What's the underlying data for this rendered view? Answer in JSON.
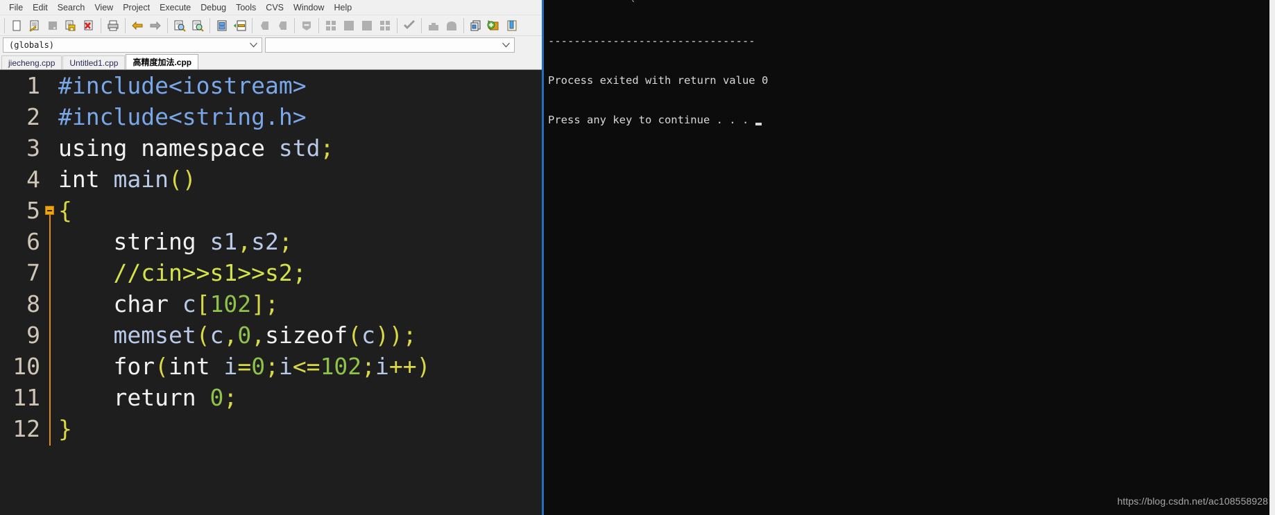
{
  "app": {
    "name": "Dev-C++",
    "accent_color": "#2a6dbf",
    "editor_bg": "#1e1e1e",
    "console_bg": "#0c0c0c"
  },
  "menubar": {
    "items": [
      {
        "label": "File",
        "name": "menu-file"
      },
      {
        "label": "Edit",
        "name": "menu-edit"
      },
      {
        "label": "Search",
        "name": "menu-search"
      },
      {
        "label": "View",
        "name": "menu-view"
      },
      {
        "label": "Project",
        "name": "menu-project"
      },
      {
        "label": "Execute",
        "name": "menu-execute"
      },
      {
        "label": "Debug",
        "name": "menu-debug"
      },
      {
        "label": "Tools",
        "name": "menu-tools"
      },
      {
        "label": "CVS",
        "name": "menu-cvs"
      },
      {
        "label": "Window",
        "name": "menu-window"
      },
      {
        "label": "Help",
        "name": "menu-help"
      }
    ]
  },
  "toolbar": {
    "icons": [
      "new-file-icon",
      "open-file-icon",
      "save-file-icon",
      "save-all-icon",
      "close-file-icon",
      "print-icon",
      "undo-icon",
      "redo-icon",
      "find-icon",
      "replace-icon",
      "goto-line-icon",
      "goto-function-icon",
      "compile-icon",
      "run-icon",
      "compile-and-run-icon",
      "rebuild-all-icon",
      "syntax-check-icon",
      "debug-icon",
      "profile-icon",
      "new-project-icon",
      "add-to-project-icon",
      "project-manager-icon"
    ]
  },
  "combos": {
    "scope": {
      "value": "(globals)",
      "placeholder": "(globals)"
    },
    "symbol": {
      "value": "",
      "placeholder": ""
    }
  },
  "tabs": [
    {
      "label": "jiecheng.cpp",
      "active": false
    },
    {
      "label": "Untitled1.cpp",
      "active": false
    },
    {
      "label": "高精度加法.cpp",
      "active": true
    }
  ],
  "editor": {
    "line_numbers": [
      "1",
      "2",
      "3",
      "4",
      "5",
      "6",
      "7",
      "8",
      "9",
      "10",
      "11",
      "12"
    ],
    "fold_marker_line": 5,
    "lines": [
      {
        "n": 1,
        "tokens": [
          {
            "t": "#include<iostream>",
            "c": "t-pre"
          }
        ]
      },
      {
        "n": 2,
        "tokens": [
          {
            "t": "#include<string.h>",
            "c": "t-pre"
          }
        ]
      },
      {
        "n": 3,
        "tokens": [
          {
            "t": "using namespace ",
            "c": "t-plain"
          },
          {
            "t": "std",
            "c": "t-id"
          },
          {
            "t": ";",
            "c": "t-punct"
          }
        ]
      },
      {
        "n": 4,
        "tokens": [
          {
            "t": "int ",
            "c": "t-plain"
          },
          {
            "t": "main",
            "c": "t-id"
          },
          {
            "t": "()",
            "c": "t-punct"
          }
        ]
      },
      {
        "n": 5,
        "tokens": [
          {
            "t": "{",
            "c": "t-brace"
          }
        ]
      },
      {
        "n": 6,
        "tokens": [
          {
            "t": "    string ",
            "c": "t-plain"
          },
          {
            "t": "s1",
            "c": "t-id"
          },
          {
            "t": ",",
            "c": "t-punct"
          },
          {
            "t": "s2",
            "c": "t-id"
          },
          {
            "t": ";",
            "c": "t-punct"
          }
        ]
      },
      {
        "n": 7,
        "tokens": [
          {
            "t": "    //cin>>s1>>s2;",
            "c": "t-com"
          }
        ]
      },
      {
        "n": 8,
        "tokens": [
          {
            "t": "    char ",
            "c": "t-plain"
          },
          {
            "t": "c",
            "c": "t-id"
          },
          {
            "t": "[",
            "c": "t-punct"
          },
          {
            "t": "102",
            "c": "t-num"
          },
          {
            "t": "]",
            "c": "t-punct"
          },
          {
            "t": ";",
            "c": "t-punct"
          }
        ]
      },
      {
        "n": 9,
        "tokens": [
          {
            "t": "    ",
            "c": "t-plain"
          },
          {
            "t": "memset",
            "c": "t-id"
          },
          {
            "t": "(",
            "c": "t-punct"
          },
          {
            "t": "c",
            "c": "t-id"
          },
          {
            "t": ",",
            "c": "t-punct"
          },
          {
            "t": "0",
            "c": "t-num"
          },
          {
            "t": ",",
            "c": "t-punct"
          },
          {
            "t": "sizeof",
            "c": "t-plain"
          },
          {
            "t": "(",
            "c": "t-punct"
          },
          {
            "t": "c",
            "c": "t-id"
          },
          {
            "t": ")",
            "c": "t-punct"
          },
          {
            "t": ")",
            "c": "t-punct"
          },
          {
            "t": ";",
            "c": "t-punct"
          }
        ]
      },
      {
        "n": 10,
        "tokens": [
          {
            "t": "    for",
            "c": "t-plain"
          },
          {
            "t": "(",
            "c": "t-punct"
          },
          {
            "t": "int ",
            "c": "t-plain"
          },
          {
            "t": "i",
            "c": "t-id"
          },
          {
            "t": "=",
            "c": "t-punct"
          },
          {
            "t": "0",
            "c": "t-num"
          },
          {
            "t": ";",
            "c": "t-punct"
          },
          {
            "t": "i",
            "c": "t-id"
          },
          {
            "t": "<=",
            "c": "t-punct"
          },
          {
            "t": "102",
            "c": "t-num"
          },
          {
            "t": ";",
            "c": "t-punct"
          },
          {
            "t": "i",
            "c": "t-id"
          },
          {
            "t": "++",
            "c": "t-punct"
          },
          {
            "t": ")",
            "c": "t-punct"
          }
        ]
      },
      {
        "n": 11,
        "tokens": [
          {
            "t": "    return ",
            "c": "t-plain"
          },
          {
            "t": "0",
            "c": "t-num"
          },
          {
            "t": ";",
            "c": "t-punct"
          }
        ]
      },
      {
        "n": 12,
        "tokens": [
          {
            "t": "}",
            "c": "t-brace"
          }
        ]
      }
    ]
  },
  "console": {
    "separator": "--------------------------------",
    "line1": "Process exited with return value 0",
    "line2": "Press any key to continue . . . "
  },
  "watermark": {
    "text": "https://blog.csdn.net/ac108558928"
  }
}
